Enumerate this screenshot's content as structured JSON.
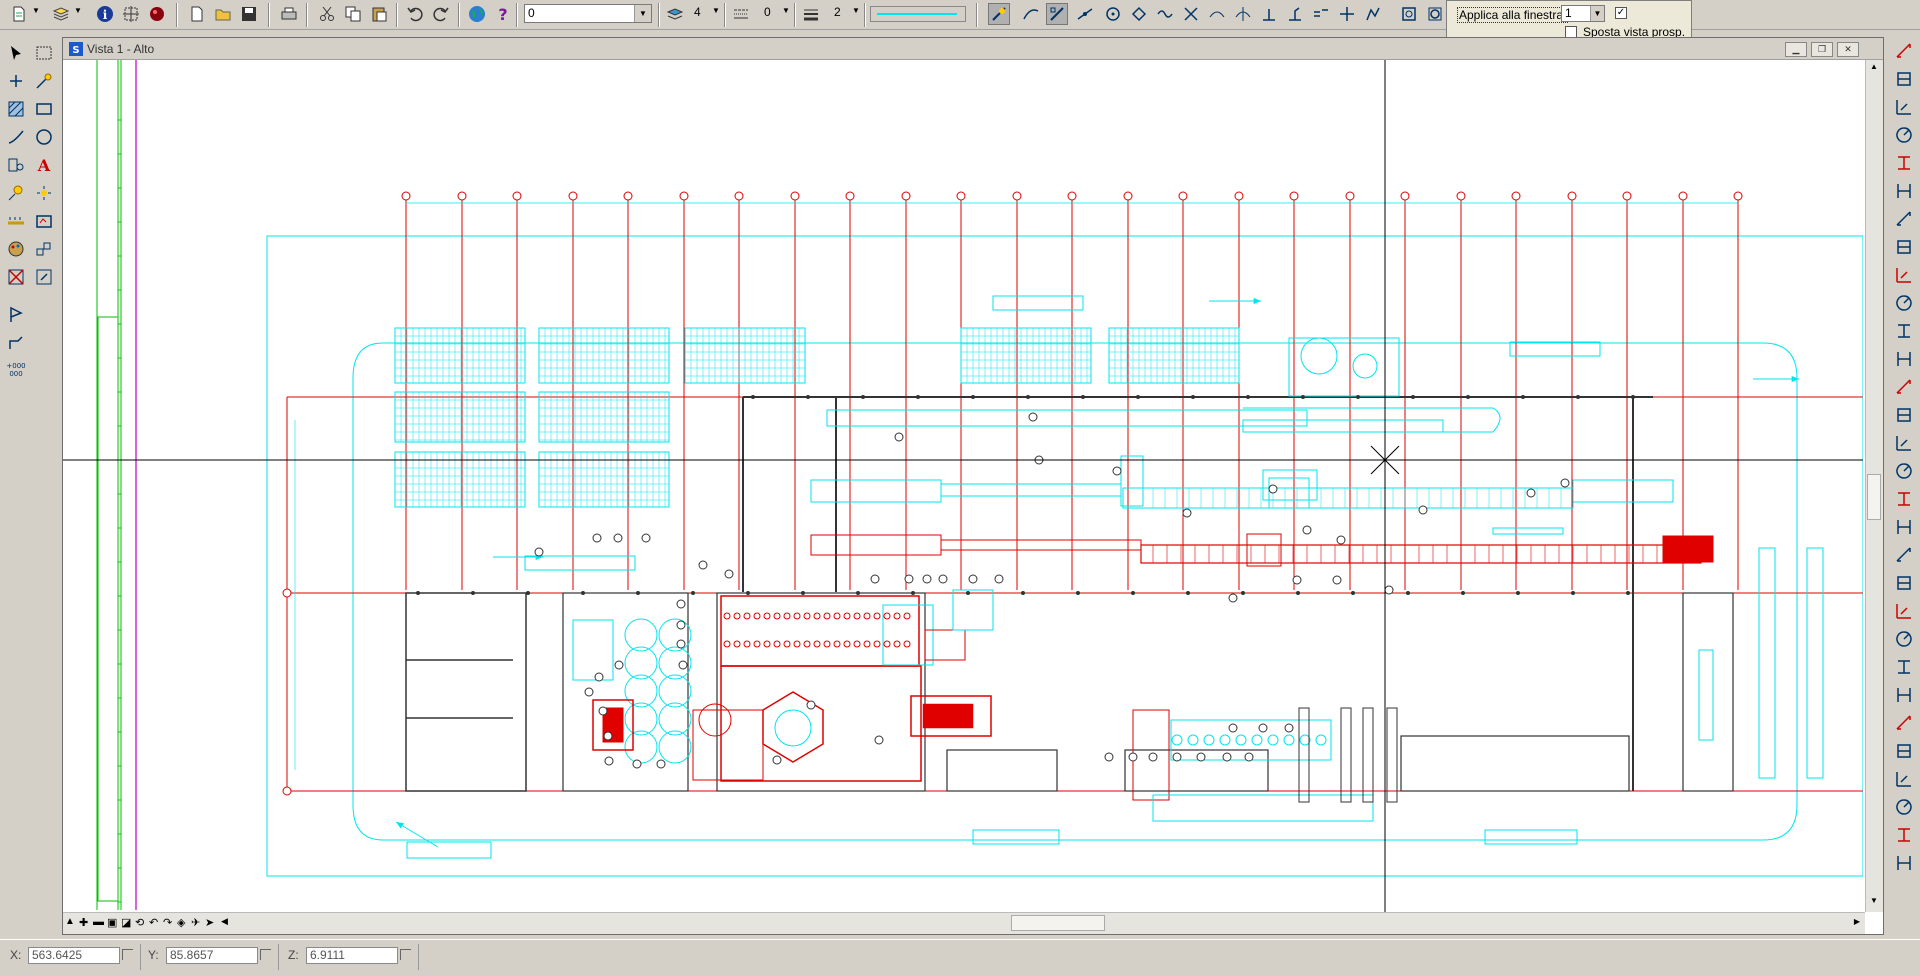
{
  "toolbar": {
    "layer_value": "0",
    "color_number": "4",
    "linetype_number": "0",
    "lineweight_number": "2"
  },
  "apply_panel": {
    "apply_label": "Applica alla finestra:",
    "apply_value": "1",
    "move_persp_label": "Sposta vista prosp."
  },
  "vista": {
    "title": "Vista 1 - Alto"
  },
  "status": {
    "x_label": "X:",
    "x_value": "563.6425",
    "y_label": "Y:",
    "y_value": "85.8657",
    "z_label": "Z:",
    "z_value": "6.9111"
  },
  "colors": {
    "cad_cyan": "#00e5ee",
    "cad_red": "#e00000",
    "cad_green": "#00c000",
    "cad_magenta": "#c000c0",
    "crosshair": "#000000"
  }
}
